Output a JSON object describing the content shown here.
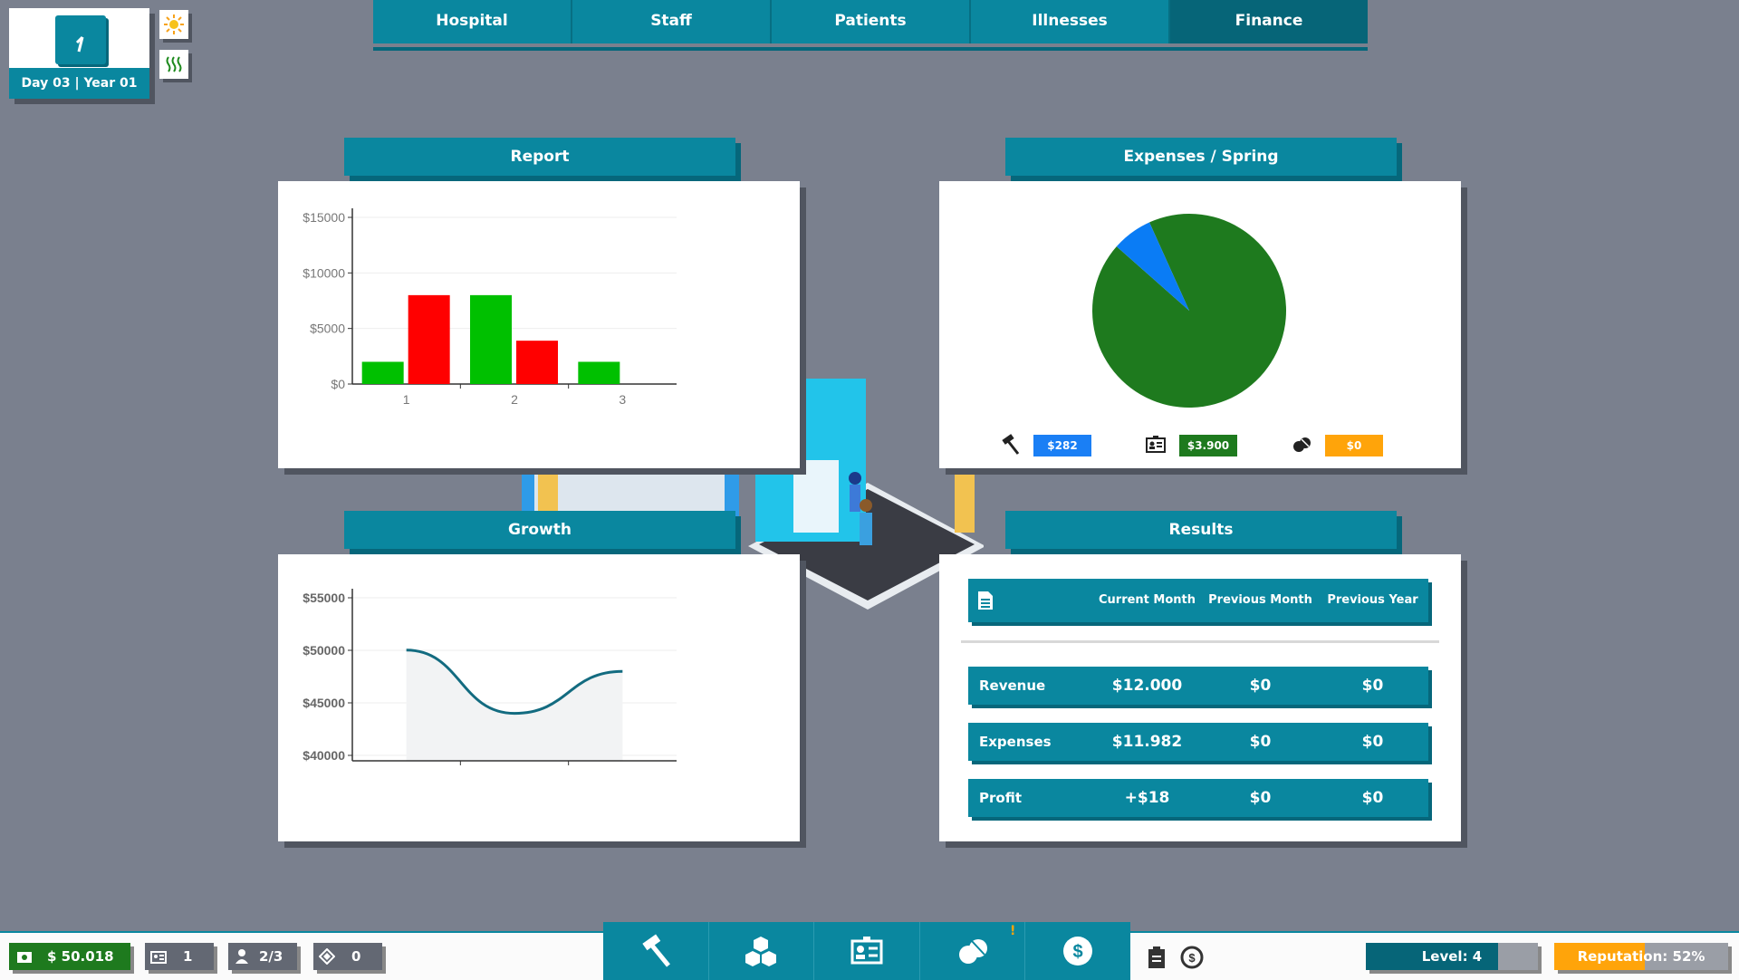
{
  "clock": {
    "date": "Day 03 | Year 01"
  },
  "tabs": [
    {
      "label": "Hospital"
    },
    {
      "label": "Staff"
    },
    {
      "label": "Patients"
    },
    {
      "label": "Illnesses"
    },
    {
      "label": "Finance"
    }
  ],
  "report": {
    "title": "Report"
  },
  "expenses": {
    "title": "Expenses / Spring",
    "legend": [
      {
        "icon": "hammer-icon",
        "value": "$282",
        "color": "#1a7ff5"
      },
      {
        "icon": "staff-card-icon",
        "value": "$3.900",
        "color": "#1e7a1e"
      },
      {
        "icon": "pills-icon",
        "value": "$0",
        "color": "#ffa40a"
      }
    ]
  },
  "growth": {
    "title": "Growth"
  },
  "results": {
    "title": "Results",
    "columns": [
      "Current Month",
      "Previous Month",
      "Previous Year"
    ],
    "rows": [
      {
        "label": "Revenue",
        "current": "$12.000",
        "prev_month": "$0",
        "prev_year": "$0"
      },
      {
        "label": "Expenses",
        "current": "$11.982",
        "prev_month": "$0",
        "prev_year": "$0"
      },
      {
        "label": "Profit",
        "current": "+$18",
        "prev_month": "$0",
        "prev_year": "$0"
      }
    ]
  },
  "bottom": {
    "money": "$ 50.018",
    "staff": "1",
    "patients": "2/3",
    "items": "0",
    "notification": "!",
    "level": "Level: 4",
    "level_progress": 0.77,
    "reputation": "Reputation: 52%",
    "reputation_progress": 0.52
  },
  "chart_data": [
    {
      "type": "bar",
      "categories": [
        "1",
        "2",
        "3"
      ],
      "series": [
        {
          "values": [
            2000,
            8000,
            2000
          ],
          "color": "#00c000"
        },
        {
          "values": [
            8000,
            3900,
            0
          ],
          "color": "#ff0000"
        }
      ],
      "yticks": [
        "$0",
        "$5000",
        "$10000",
        "$15000"
      ],
      "ylim": [
        0,
        15000
      ]
    },
    {
      "type": "pie",
      "values": [
        3900,
        282
      ],
      "colors": [
        "#1e7a1e",
        "#0a7cf5"
      ]
    },
    {
      "type": "area",
      "x": [
        1,
        2,
        3
      ],
      "values": [
        50018,
        44000,
        48000
      ],
      "yticks": [
        "$40000",
        "$45000",
        "$50000",
        "$55000"
      ],
      "ylim": [
        40000,
        55000
      ],
      "line_color": "#136b80"
    }
  ]
}
